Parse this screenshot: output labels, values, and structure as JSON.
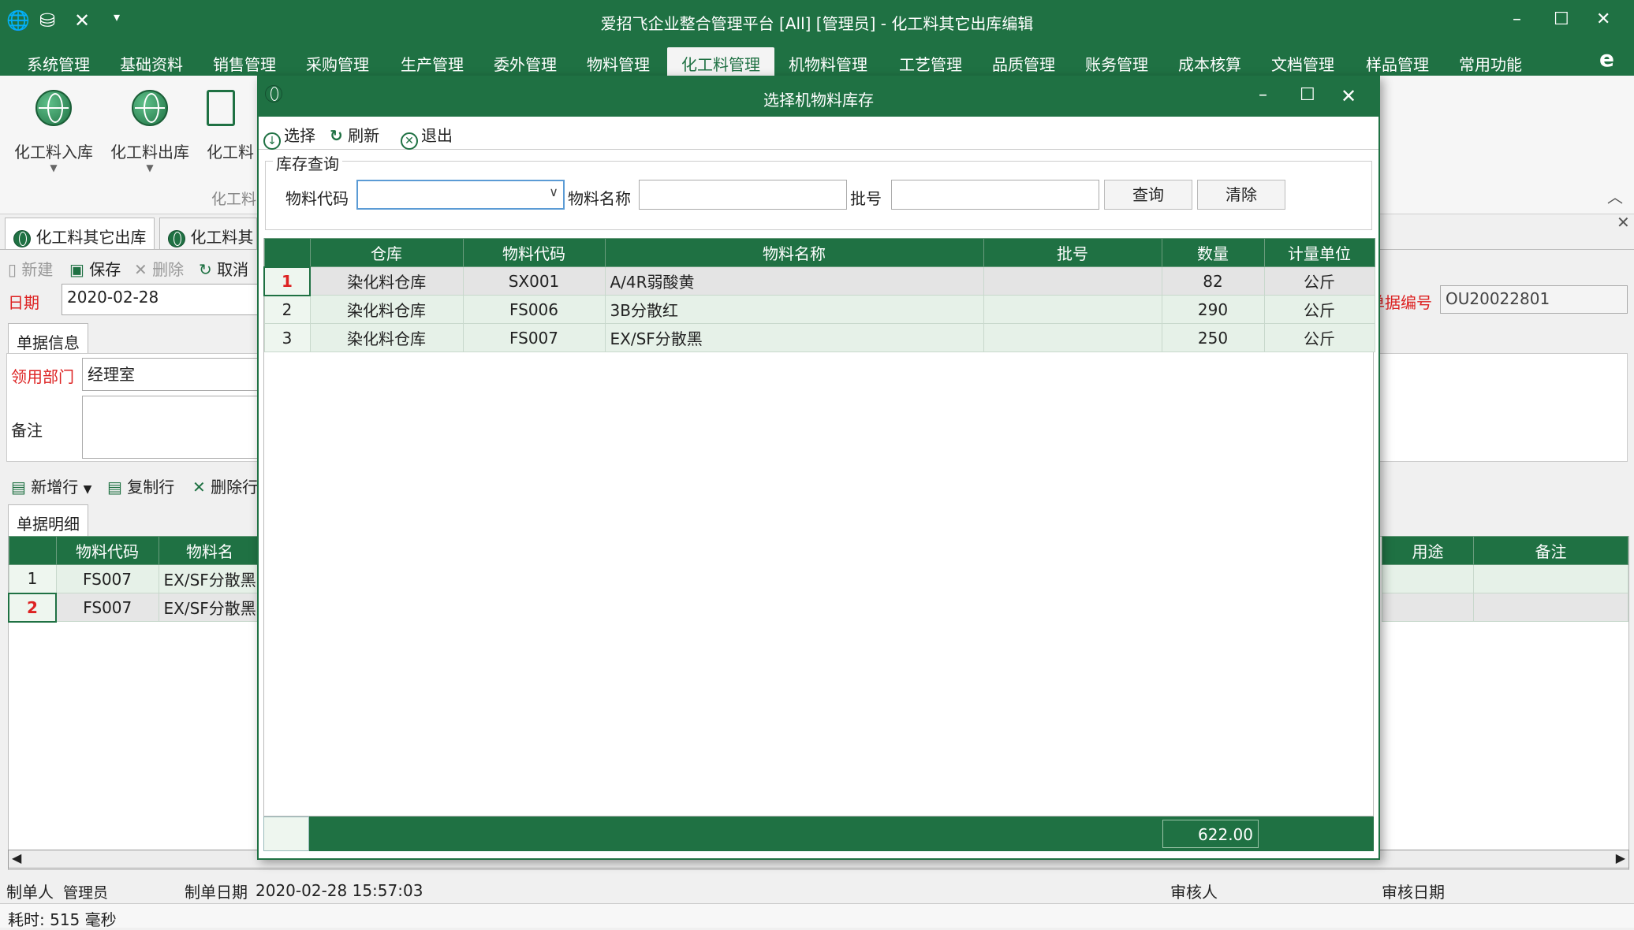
{
  "window": {
    "title": "爱招飞企业整合管理平台 [All] [管理员] - 化工料其它出库编辑"
  },
  "menu": [
    "系统管理",
    "基础资料",
    "销售管理",
    "采购管理",
    "生产管理",
    "委外管理",
    "物料管理",
    "化工料管理",
    "机物料管理",
    "工艺管理",
    "品质管理",
    "账务管理",
    "成本核算",
    "文档管理",
    "样品管理",
    "常用功能"
  ],
  "ribbon": {
    "btn1": "化工料入库",
    "btn2": "化工料出库",
    "btn3": "化工料",
    "group": "化工料"
  },
  "tabs": {
    "tab1": "化工料其它出库",
    "tab2": "化工料其"
  },
  "toolbar": {
    "new": "新建",
    "save": "保存",
    "delete": "删除",
    "cancel": "取消"
  },
  "form": {
    "date_label": "日期",
    "date_value": "2020-02-28",
    "doc_no_label": "单据编号",
    "doc_no_value": "OU20022801",
    "info_tab": "单据信息",
    "dept_label": "领用部门",
    "dept_value": "经理室",
    "remark_label": "备注",
    "detail_tab": "单据明细"
  },
  "rowtools": {
    "add": "新增行",
    "copy": "复制行",
    "del": "删除行"
  },
  "detail": {
    "headers": [
      "物料代码",
      "物料名",
      "用途",
      "备注"
    ],
    "rows": [
      {
        "no": "1",
        "code": "FS007",
        "name": "EX/SF分散黑"
      },
      {
        "no": "2",
        "code": "FS007",
        "name": "EX/SF分散黑"
      }
    ]
  },
  "footer": {
    "maker_label": "制单人",
    "maker": "管理员",
    "date_label": "制单日期",
    "date": "2020-02-28 15:57:03",
    "auditor_label": "审核人",
    "audit_date_label": "审核日期",
    "elapsed": "耗时: 515 毫秒"
  },
  "dialog": {
    "title": "选择机物料库存",
    "select": "选择",
    "refresh": "刷新",
    "exit": "退出",
    "fieldset": "库存查询",
    "code_label": "物料代码",
    "name_label": "物料名称",
    "batch_label": "批号",
    "query": "查询",
    "clear": "清除",
    "headers": [
      "仓库",
      "物料代码",
      "物料名称",
      "批号",
      "数量",
      "计量单位"
    ],
    "rows": [
      {
        "no": "1",
        "wh": "染化料仓库",
        "code": "SX001",
        "name": "A/4R弱酸黄",
        "batch": "",
        "qty": "82",
        "unit": "公斤"
      },
      {
        "no": "2",
        "wh": "染化料仓库",
        "code": "FS006",
        "name": "3B分散红",
        "batch": "",
        "qty": "290",
        "unit": "公斤"
      },
      {
        "no": "3",
        "wh": "染化料仓库",
        "code": "FS007",
        "name": "EX/SF分散黑",
        "batch": "",
        "qty": "250",
        "unit": "公斤"
      }
    ],
    "total": "622.00"
  }
}
